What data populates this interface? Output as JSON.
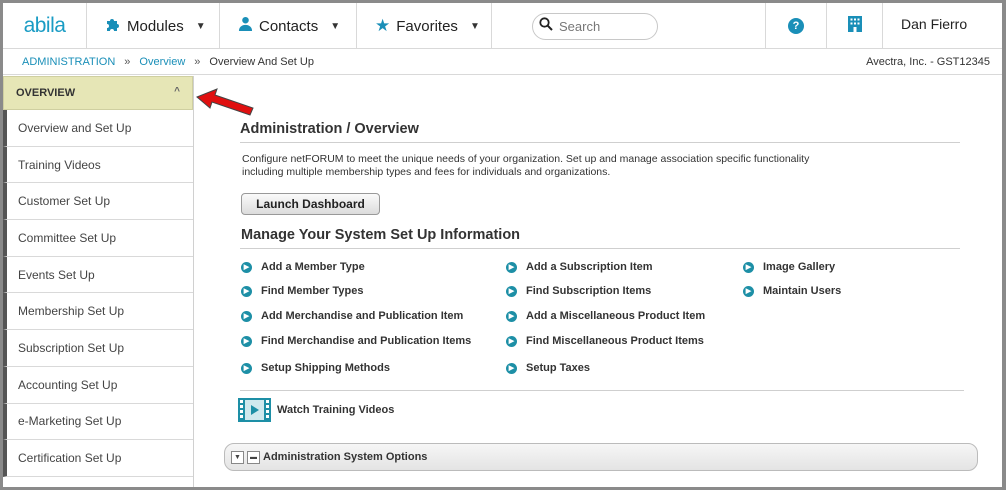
{
  "topnav": {
    "logo": "abila",
    "modules": "Modules",
    "contacts": "Contacts",
    "favorites": "Favorites",
    "search_placeholder": "Search",
    "help": "?",
    "user": "Dan Fierro"
  },
  "breadcrumb": {
    "items": [
      "ADMINISTRATION",
      "Overview",
      "Overview And Set Up"
    ],
    "separator": "»",
    "org": "Avectra, Inc. - GST12345"
  },
  "sidebar": {
    "header": "OVERVIEW",
    "items": [
      "Overview and Set Up",
      "Training Videos",
      "Customer Set Up",
      "Committee Set Up",
      "Events Set Up",
      "Membership Set Up",
      "Subscription Set Up",
      "Accounting Set Up",
      "e-Marketing Set Up",
      "Certification Set Up"
    ]
  },
  "main": {
    "title": "Administration / Overview",
    "description": "Configure netFORUM to meet the unique needs of your organization. Set up and manage association specific functionality including multiple membership types and fees for individuals and organizations.",
    "launch_button": "Launch Dashboard",
    "section_title": "Manage Your System Set Up Information",
    "links": {
      "col1": [
        "Add a Member Type",
        "Find Member Types",
        "Add Merchandise and Publication Item",
        "Find Merchandise and Publication Items",
        "Setup Shipping Methods"
      ],
      "col2": [
        "Add a Subscription Item",
        "Find Subscription Items",
        "Add a Miscellaneous Product Item",
        "Find Miscellaneous Product Items",
        "Setup Taxes"
      ],
      "col3": [
        "Image Gallery",
        "Maintain Users"
      ]
    },
    "video_link": "Watch Training Videos",
    "options_title": "Administration System Options"
  },
  "colors": {
    "accent": "#1a8fb8",
    "sidebar_header_bg": "#e6e6b6",
    "arrow": "#e01010"
  }
}
